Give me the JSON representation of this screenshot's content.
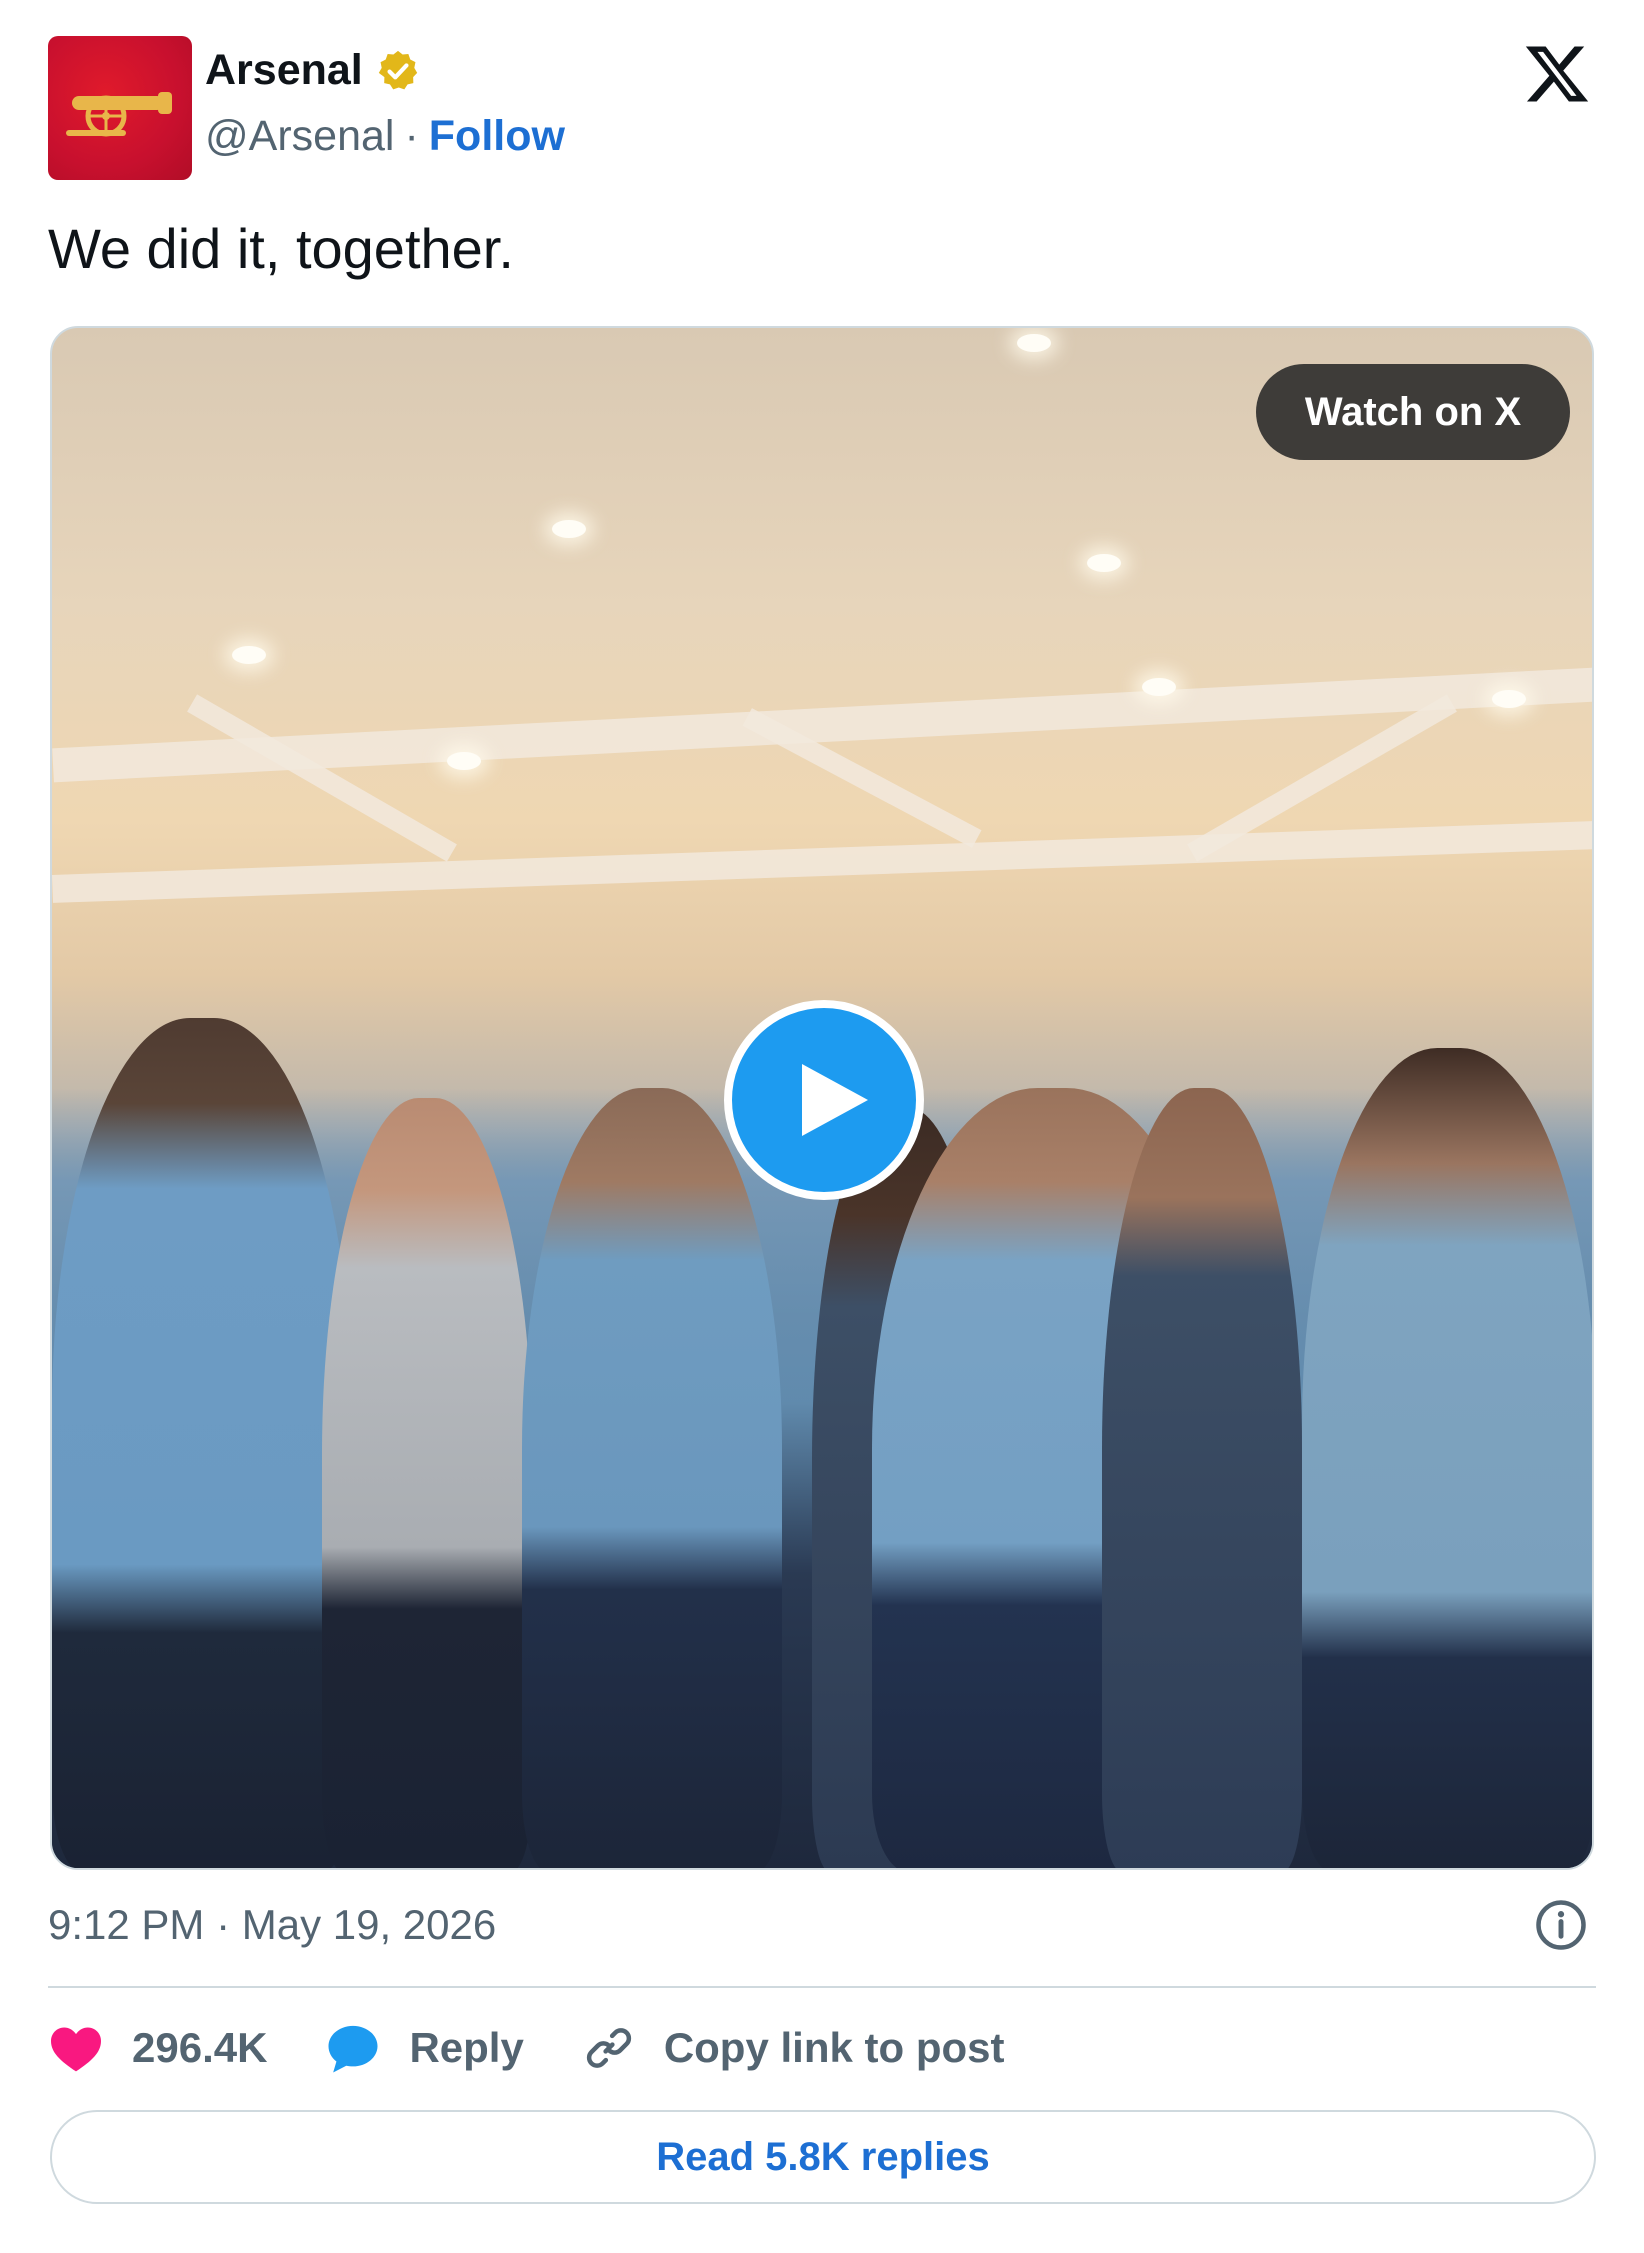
{
  "author": {
    "name": "Arsenal",
    "handle": "@Arsenal",
    "separator": "·",
    "follow_label": "Follow",
    "verified": true,
    "brand_color": "#c8102e"
  },
  "tweet": {
    "text": "We did it, together."
  },
  "media": {
    "watch_label": "Watch on X",
    "play_icon": "play-icon"
  },
  "footer": {
    "timestamp": "9:12 PM · May 19, 2026",
    "likes": "296.4K",
    "reply_label": "Reply",
    "copy_label": "Copy link to post",
    "read_replies_label": "Read 5.8K replies"
  },
  "colors": {
    "link": "#1d6fd3",
    "like": "#f91880",
    "reply": "#1d9bf0",
    "secondary_text": "#536471",
    "border": "#cfd9de"
  }
}
